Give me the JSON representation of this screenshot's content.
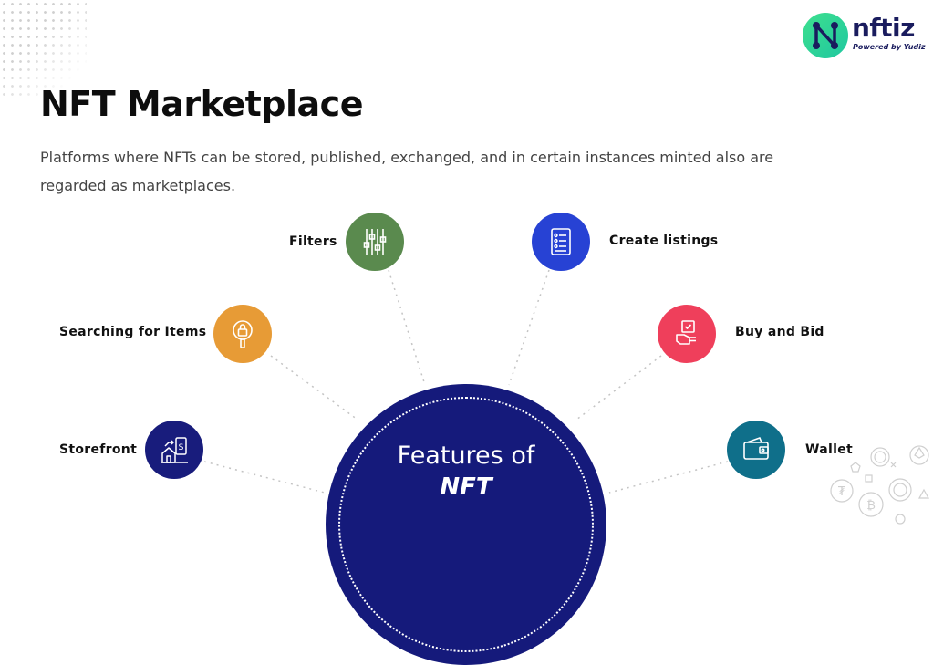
{
  "brand": {
    "name": "nftiz",
    "tagline": "Powered by Yudiz",
    "colors": {
      "primary": "#151a7b",
      "accent": "#2fd596"
    }
  },
  "heading": "NFT Marketplace",
  "description": "Platforms where NFTs can be stored, published, exchanged, and in certain instances minted also are regarded as marketplaces.",
  "hub": {
    "line1": "Features of",
    "line2": "NFT"
  },
  "features": [
    {
      "label": "Filters",
      "icon": "sliders-icon",
      "color": "#5a8a4e"
    },
    {
      "label": "Create listings",
      "icon": "checklist-icon",
      "color": "#2742d4"
    },
    {
      "label": "Searching for Items",
      "icon": "magnifier-lock-icon",
      "color": "#e79b36"
    },
    {
      "label": "Buy and Bid",
      "icon": "hand-bid-icon",
      "color": "#ef3f5b"
    },
    {
      "label": "Storefront",
      "icon": "store-dollar-icon",
      "color": "#181c7c"
    },
    {
      "label": "Wallet",
      "icon": "wallet-icon",
      "color": "#0f6f8a"
    }
  ]
}
